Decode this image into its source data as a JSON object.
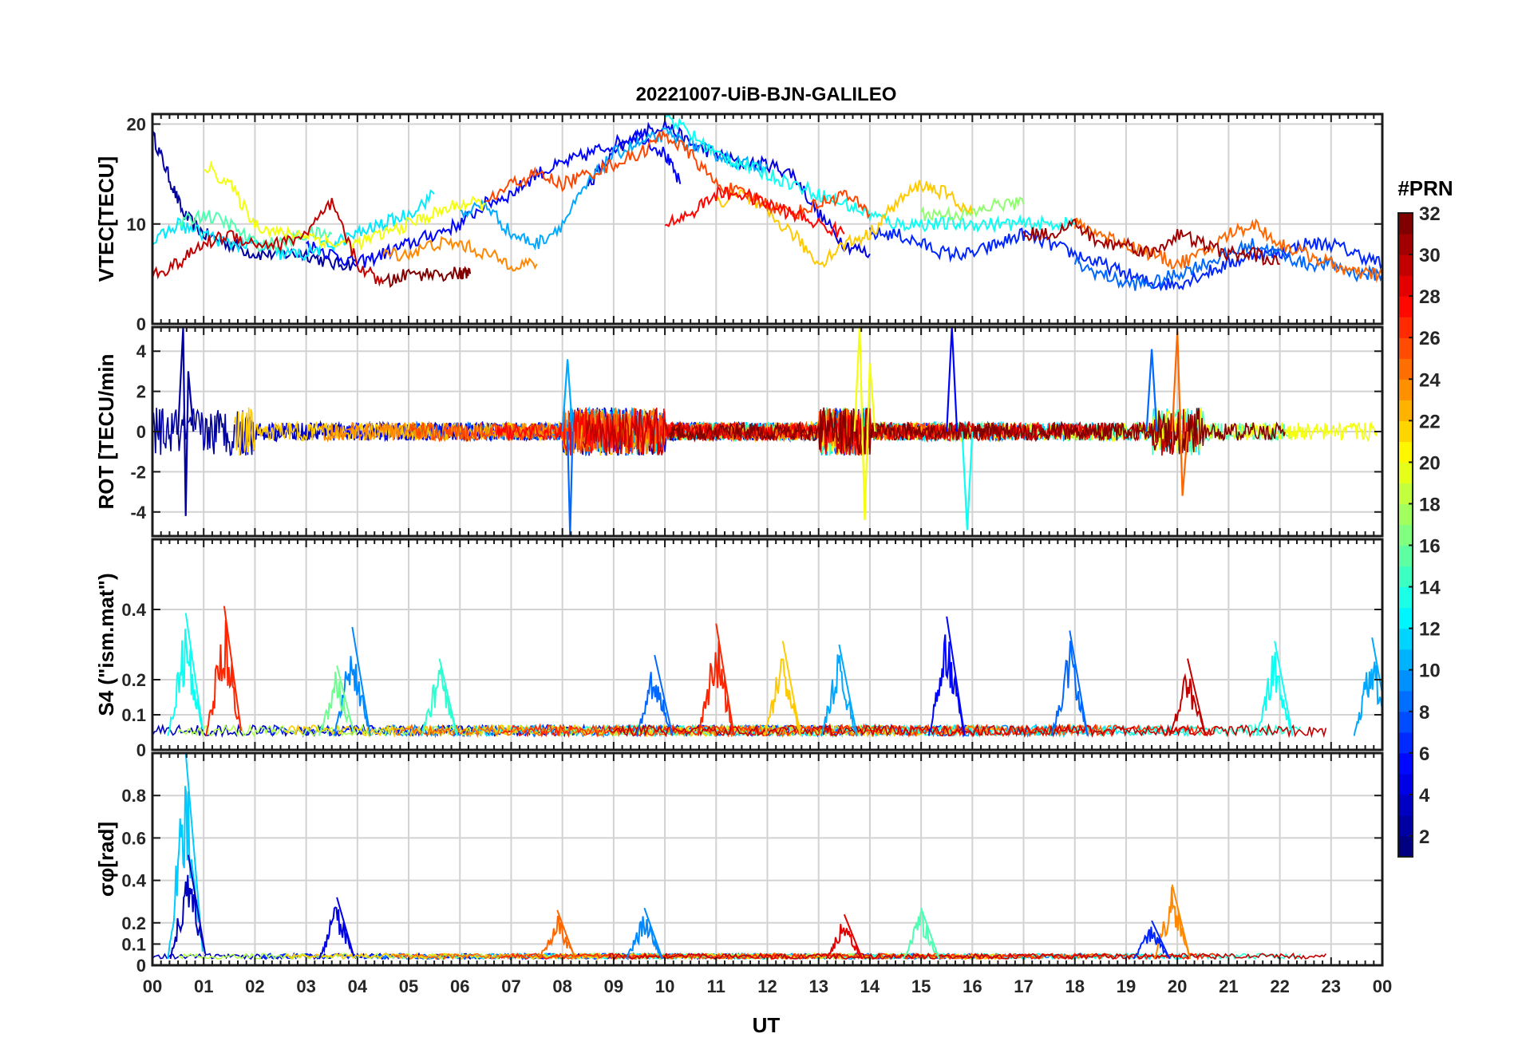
{
  "figure": {
    "title": "20221007-UiB-BJN-GALILEO",
    "xlabel": "UT",
    "x_tick_labels": [
      "00",
      "01",
      "02",
      "03",
      "04",
      "05",
      "06",
      "07",
      "08",
      "09",
      "10",
      "11",
      "12",
      "13",
      "14",
      "15",
      "16",
      "17",
      "18",
      "19",
      "20",
      "21",
      "22",
      "23",
      "00"
    ]
  },
  "colorbar": {
    "title": "#PRN",
    "range": [
      1,
      32
    ],
    "tick_labels": [
      "2",
      "4",
      "6",
      "8",
      "10",
      "12",
      "14",
      "16",
      "18",
      "20",
      "22",
      "24",
      "26",
      "28",
      "30",
      "32"
    ],
    "colormap": "jet"
  },
  "chart_data": [
    {
      "type": "line",
      "panel": "vtec",
      "ylabel": "VTEC[TECU]",
      "xlim": [
        0,
        24
      ],
      "ylim": [
        0,
        21
      ],
      "y_ticks": [
        0,
        10,
        20
      ],
      "grid": true,
      "series": [
        {
          "prn": 2,
          "x": [
            0,
            0.3,
            0.6,
            1,
            1.5,
            2,
            2.5,
            3,
            3.5,
            4
          ],
          "y": [
            19,
            15,
            11,
            9,
            8,
            7,
            7,
            7,
            6,
            6
          ]
        },
        {
          "prn": 4,
          "x": [
            8.5,
            9,
            9.5,
            10,
            10.5,
            11,
            11.5,
            12,
            12.5,
            13,
            13.5,
            14
          ],
          "y": [
            14,
            17,
            19,
            20,
            18,
            17,
            16,
            16,
            15,
            11,
            8,
            7
          ]
        },
        {
          "prn": 5,
          "x": [
            3,
            3.5,
            4,
            4.5,
            5,
            5.5,
            6,
            6.5,
            7,
            7.5,
            8,
            8.5,
            9,
            9.5,
            10,
            10.3
          ],
          "y": [
            8,
            7,
            6,
            7,
            8,
            9,
            10,
            12,
            13,
            15,
            16,
            17,
            18,
            19,
            17,
            14
          ]
        },
        {
          "prn": 6,
          "x": [
            14,
            14.5,
            15,
            15.5,
            16,
            16.5,
            17,
            17.5,
            18,
            18.5,
            19,
            19.5,
            20,
            20.5,
            21,
            21.5,
            22,
            22.5,
            23,
            23.5,
            24
          ],
          "y": [
            9,
            9,
            8,
            7,
            7,
            8,
            9,
            8,
            7,
            6,
            5,
            4,
            4,
            5,
            6,
            7,
            7,
            8,
            8,
            7,
            6
          ]
        },
        {
          "prn": 8,
          "x": [
            18,
            18.5,
            19,
            19.5,
            20,
            20.5,
            21,
            21.5,
            22,
            22.5,
            23,
            23.5,
            24
          ],
          "y": [
            6,
            5,
            4,
            4,
            5,
            6,
            7,
            8,
            7,
            6,
            6,
            5,
            5
          ]
        },
        {
          "prn": 10,
          "x": [
            6,
            6.5,
            7,
            7.5,
            8,
            8.5,
            9,
            9.5,
            10,
            10.5,
            11,
            11.5,
            12
          ],
          "y": [
            11,
            12,
            9,
            8,
            10,
            14,
            17,
            18,
            19,
            18,
            17,
            16,
            16
          ]
        },
        {
          "prn": 12,
          "x": [
            0,
            0.5,
            1,
            1.5,
            2,
            2.5,
            3,
            3.5,
            4,
            4.5,
            5,
            5.5
          ],
          "y": [
            8,
            10,
            9,
            8,
            8,
            7,
            7,
            8,
            9,
            10,
            11,
            13
          ]
        },
        {
          "prn": 13,
          "x": [
            10,
            10.5,
            11,
            11.5,
            12,
            12.5,
            13,
            13.5,
            14,
            14.5,
            15,
            15.5,
            16,
            16.5,
            17,
            17.5,
            18
          ],
          "y": [
            21,
            19,
            17,
            16,
            15,
            14,
            13,
            12,
            11,
            10,
            10,
            10,
            10,
            10,
            10,
            10,
            10
          ]
        },
        {
          "prn": 15,
          "x": [
            0.5,
            1,
            1.5,
            2,
            2.5,
            3,
            3.5
          ],
          "y": [
            10,
            11,
            10,
            8,
            8,
            9,
            9
          ]
        },
        {
          "prn": 17,
          "x": [
            15,
            15.5,
            16,
            16.5,
            17
          ],
          "y": [
            11,
            11,
            11,
            12,
            12
          ]
        },
        {
          "prn": 20,
          "x": [
            1,
            1.5,
            2,
            2.5,
            3,
            3.5,
            4,
            4.5,
            5,
            5.5,
            6,
            6.5
          ],
          "y": [
            16,
            14,
            10,
            9,
            9,
            8,
            8,
            9,
            10,
            11,
            12,
            12
          ]
        },
        {
          "prn": 22,
          "x": [
            11,
            11.5,
            12,
            12.5,
            13,
            13.5,
            14,
            14.5,
            15,
            15.5,
            16
          ],
          "y": [
            12,
            13,
            11,
            9,
            6,
            8,
            9,
            12,
            14,
            13,
            11
          ]
        },
        {
          "prn": 24,
          "x": [
            4.5,
            5,
            5.5,
            6,
            6.5,
            7,
            7.5
          ],
          "y": [
            7,
            7,
            8,
            8,
            7,
            6,
            6
          ]
        },
        {
          "prn": 25,
          "x": [
            18,
            18.5,
            19,
            19.5,
            20,
            20.5,
            21,
            21.5,
            22,
            22.5,
            23,
            23.5,
            24
          ],
          "y": [
            10,
            9,
            8,
            7,
            6,
            7,
            9,
            10,
            8,
            7,
            6,
            5,
            5
          ]
        },
        {
          "prn": 26,
          "x": [
            6.5,
            7,
            7.5,
            8,
            8.5,
            9,
            9.5,
            10,
            10.5,
            11,
            11.5,
            12,
            12.5,
            13,
            13.5,
            14
          ],
          "y": [
            12,
            14,
            15,
            14,
            15,
            16,
            17,
            19,
            17,
            14,
            13,
            12,
            11,
            12,
            13,
            11
          ]
        },
        {
          "prn": 28,
          "x": [
            10,
            10.5,
            11,
            11.5,
            12,
            12.5,
            13,
            13.5
          ],
          "y": [
            10,
            11,
            13,
            13,
            12,
            11,
            10,
            9
          ]
        },
        {
          "prn": 30,
          "x": [
            0,
            0.5,
            1,
            1.5,
            2,
            2.5,
            3,
            3.5,
            4,
            4.5
          ],
          "y": [
            5,
            6,
            8,
            9,
            8,
            8,
            9,
            12,
            6,
            4
          ]
        },
        {
          "prn": 31,
          "x": [
            17,
            17.5,
            18,
            18.5,
            19,
            19.5,
            20,
            20.5,
            21,
            21.5,
            22
          ],
          "y": [
            9,
            9,
            10,
            8,
            8,
            7,
            9,
            8,
            7,
            7,
            6
          ]
        },
        {
          "prn": 32,
          "x": [
            4.5,
            5,
            5.5,
            6,
            6.2
          ],
          "y": [
            4,
            5,
            5,
            5,
            5
          ]
        }
      ]
    },
    {
      "type": "line",
      "panel": "rot",
      "ylabel": "ROT [TECU/min",
      "xlim": [
        0,
        24
      ],
      "ylim": [
        -5.2,
        5.2
      ],
      "y_ticks": [
        -4,
        -2,
        0,
        2,
        4
      ],
      "grid": true,
      "note_series": "noise around 0 for PRN 2,4,5,8,10,12,15,20,22,24,26,28,30,32",
      "series": [
        {
          "prn": 2,
          "x": [
            0.5,
            0.6,
            0.65,
            0.7,
            0.8
          ],
          "y": [
            0,
            5.2,
            -4.2,
            3,
            0
          ]
        },
        {
          "prn": 8,
          "x": [
            8.1,
            8.15,
            8.2
          ],
          "y": [
            0,
            -5.2,
            0
          ]
        },
        {
          "prn": 10,
          "x": [
            8,
            8.1,
            8.2
          ],
          "y": [
            0,
            3.6,
            0
          ]
        },
        {
          "prn": 20,
          "x": [
            13.7,
            13.8,
            13.9,
            14,
            14.1
          ],
          "y": [
            0,
            5.2,
            -4.4,
            3.4,
            0
          ]
        },
        {
          "prn": 5,
          "x": [
            15.5,
            15.6,
            15.7
          ],
          "y": [
            0,
            5.2,
            0
          ]
        },
        {
          "prn": 13,
          "x": [
            15.8,
            15.9,
            16
          ],
          "y": [
            0,
            -4.9,
            0
          ]
        },
        {
          "prn": 8,
          "x": [
            19.4,
            19.5,
            19.6
          ],
          "y": [
            0,
            4.1,
            0
          ]
        },
        {
          "prn": 25,
          "x": [
            19.9,
            20,
            20.1,
            20.2
          ],
          "y": [
            0,
            5.0,
            -3.2,
            0
          ]
        }
      ]
    },
    {
      "type": "line",
      "panel": "s4",
      "ylabel": "S4 (\"ism.mat\")",
      "xlim": [
        0,
        24
      ],
      "ylim": [
        0,
        0.6
      ],
      "y_ticks": [
        0,
        0.1,
        0.2,
        0.4
      ],
      "grid": true,
      "peaks": [
        {
          "prn": 13,
          "x": 0.65,
          "y": 0.39
        },
        {
          "prn": 27,
          "x": 1.4,
          "y": 0.41
        },
        {
          "prn": 9,
          "x": 3.9,
          "y": 0.35
        },
        {
          "prn": 16,
          "x": 3.6,
          "y": 0.24
        },
        {
          "prn": 14,
          "x": 5.6,
          "y": 0.26
        },
        {
          "prn": 8,
          "x": 9.8,
          "y": 0.27
        },
        {
          "prn": 27,
          "x": 11.0,
          "y": 0.36
        },
        {
          "prn": 22,
          "x": 12.3,
          "y": 0.31
        },
        {
          "prn": 10,
          "x": 13.4,
          "y": 0.3
        },
        {
          "prn": 5,
          "x": 15.5,
          "y": 0.38
        },
        {
          "prn": 8,
          "x": 17.9,
          "y": 0.34
        },
        {
          "prn": 30,
          "x": 20.2,
          "y": 0.26
        },
        {
          "prn": 13,
          "x": 21.9,
          "y": 0.31
        },
        {
          "prn": 10,
          "x": 23.8,
          "y": 0.32
        }
      ]
    },
    {
      "type": "line",
      "panel": "sigma_phi",
      "ylabel": "σφ[rad]",
      "xlim": [
        0,
        24
      ],
      "ylim": [
        0,
        1.0
      ],
      "y_ticks": [
        0,
        0.1,
        0.2,
        0.4,
        0.6,
        0.8
      ],
      "grid": true,
      "peaks": [
        {
          "prn": 11,
          "x": 0.65,
          "y": 1.0
        },
        {
          "prn": 3,
          "x": 0.7,
          "y": 0.52
        },
        {
          "prn": 4,
          "x": 3.6,
          "y": 0.32
        },
        {
          "prn": 25,
          "x": 7.9,
          "y": 0.26
        },
        {
          "prn": 9,
          "x": 9.6,
          "y": 0.27
        },
        {
          "prn": 15,
          "x": 15.0,
          "y": 0.27
        },
        {
          "prn": 29,
          "x": 13.5,
          "y": 0.24
        },
        {
          "prn": 24,
          "x": 19.9,
          "y": 0.38
        },
        {
          "prn": 6,
          "x": 19.5,
          "y": 0.21
        }
      ]
    }
  ]
}
